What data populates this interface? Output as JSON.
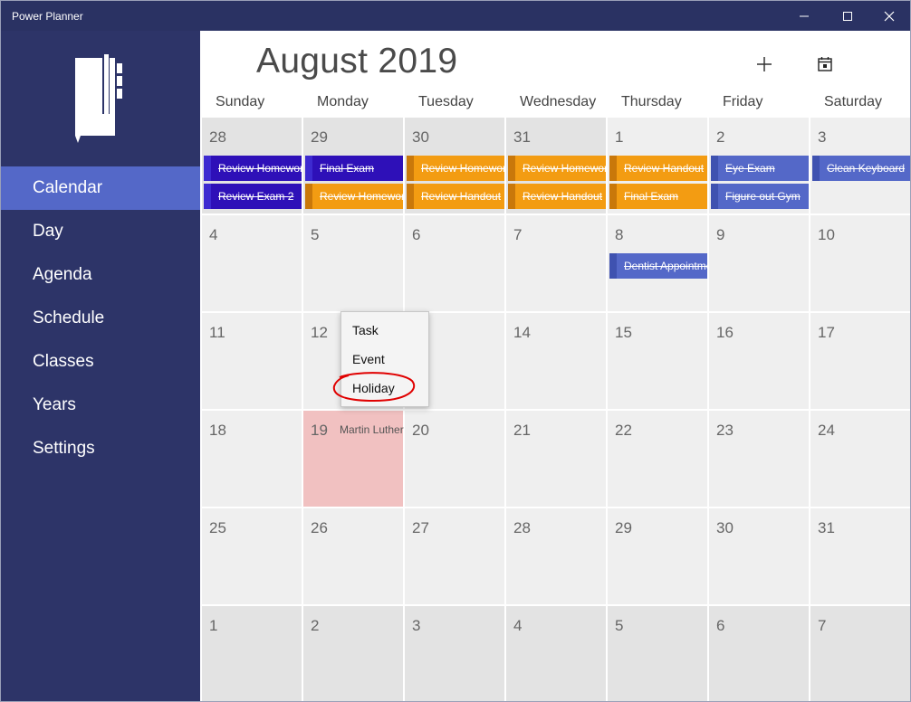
{
  "window": {
    "title": "Power Planner"
  },
  "sidebar": {
    "items": [
      {
        "label": "Calendar",
        "active": true
      },
      {
        "label": "Day"
      },
      {
        "label": "Agenda"
      },
      {
        "label": "Schedule"
      },
      {
        "label": "Classes"
      },
      {
        "label": "Years"
      },
      {
        "label": "Settings"
      }
    ]
  },
  "header": {
    "month": "August 2019",
    "add_icon": "plus-icon",
    "today_icon": "calendar-today-icon"
  },
  "weekdays": [
    "Sunday",
    "Monday",
    "Tuesday",
    "Wednesday",
    "Thursday",
    "Friday",
    "Saturday"
  ],
  "weeks": [
    [
      "28",
      "29",
      "30",
      "31",
      "1",
      "2",
      "3"
    ],
    [
      "4",
      "5",
      "6",
      "7",
      "8",
      "9",
      "10"
    ],
    [
      "11",
      "12",
      "13",
      "14",
      "15",
      "16",
      "17"
    ],
    [
      "18",
      "19",
      "20",
      "21",
      "22",
      "23",
      "24"
    ],
    [
      "25",
      "26",
      "27",
      "28",
      "29",
      "30",
      "31"
    ],
    [
      "1",
      "2",
      "3",
      "4",
      "5",
      "6",
      "7"
    ]
  ],
  "tasks": {
    "sun_1": "Review Homework",
    "sun_2": "Review Exam 2",
    "mon_1": "Final Exam",
    "mon_2": "Review Homework",
    "tue_1": "Review Homework",
    "tue_2": "Review Handout",
    "wed_1": "Review Homework",
    "wed_2": "Review Handout",
    "thu_1": "Review Handout",
    "thu_2": "Final Exam",
    "fri_1": "Eye Exam",
    "fri_2": "Figure out Gym",
    "sat_1": "Clean Keyboard",
    "thu8_1": "Dentist Appointment"
  },
  "holiday": {
    "label": "Martin Luther"
  },
  "context_menu": {
    "items": [
      "Task",
      "Event",
      "Holiday"
    ]
  },
  "colors": {
    "navy": "#2d3468",
    "accent": "#5468c8",
    "orange": "#f39c12",
    "purple": "#2e10b8",
    "holiday": "#f1c1c1",
    "annotation": "#e00000"
  }
}
